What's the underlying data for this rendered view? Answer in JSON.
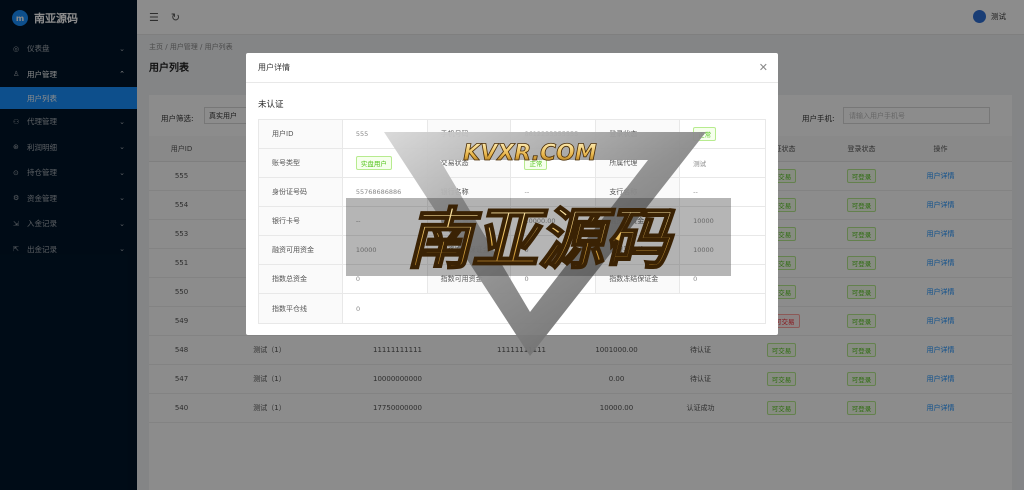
{
  "sidebar": {
    "logo": "南亚源码",
    "items": [
      {
        "label": "仪表盘",
        "icon": "dashboard-icon"
      },
      {
        "label": "用户管理",
        "icon": "user-icon"
      },
      {
        "label": "代理管理",
        "icon": "agent-icon"
      },
      {
        "label": "利润明细",
        "icon": "profit-icon"
      },
      {
        "label": "持仓管理",
        "icon": "position-icon"
      },
      {
        "label": "资金管理",
        "icon": "fund-icon"
      },
      {
        "label": "入金记录",
        "icon": "deposit-icon"
      },
      {
        "label": "出金记录",
        "icon": "withdraw-icon"
      }
    ],
    "sub_item": "用户列表"
  },
  "header": {
    "user_name": "测试"
  },
  "breadcrumb": [
    "主页",
    "用户管理",
    "用户列表"
  ],
  "page_title": "用户列表",
  "filters": {
    "user_filter_label": "用户筛选:",
    "user_filter_value": "真实用户",
    "phone_label": "用户手机:",
    "phone_placeholder": "请输入用户手机号",
    "reset": "重置",
    "search": "查询"
  },
  "table": {
    "headers": [
      "用户ID",
      "",
      "",
      "",
      "",
      "",
      "认证状态",
      "登录状态",
      "操作"
    ],
    "rows": [
      {
        "id": "555",
        "name": "",
        "phone": "",
        "bank": "",
        "amount": "",
        "auth": "",
        "trade": "可交易",
        "login": "可登录",
        "op": "用户详情"
      },
      {
        "id": "554",
        "name": "",
        "phone": "",
        "bank": "",
        "amount": "",
        "auth": "",
        "trade": "可交易",
        "login": "可登录",
        "op": "用户详情"
      },
      {
        "id": "553",
        "name": "",
        "phone": "",
        "bank": "",
        "amount": "",
        "auth": "",
        "trade": "可交易",
        "login": "可登录",
        "op": "用户详情"
      },
      {
        "id": "551",
        "name": "",
        "phone": "",
        "bank": "",
        "amount": "",
        "auth": "",
        "trade": "可交易",
        "login": "可登录",
        "op": "用户详情"
      },
      {
        "id": "550",
        "name": "测试（1）",
        "phone": "447355118737",
        "bank": "郭奔阳",
        "amount": "0.00",
        "auth": "认证成功",
        "trade": "可交易",
        "login": "可登录",
        "op": "用户详情"
      },
      {
        "id": "549",
        "name": "测试（1）",
        "phone": "447355118729",
        "bank": "",
        "amount": "0.00",
        "auth": "待认证",
        "trade": "不可交易",
        "login": "可登录",
        "op": "用户详情"
      },
      {
        "id": "548",
        "name": "测试（1）",
        "phone": "11111111111",
        "bank": "11111111111",
        "amount": "1001000.00",
        "auth": "待认证",
        "trade": "可交易",
        "login": "可登录",
        "op": "用户详情"
      },
      {
        "id": "547",
        "name": "测试（1）",
        "phone": "10000000000",
        "bank": "",
        "amount": "0.00",
        "auth": "待认证",
        "trade": "可交易",
        "login": "可登录",
        "op": "用户详情"
      },
      {
        "id": "540",
        "name": "测试（1）",
        "phone": "17750000000",
        "bank": "",
        "amount": "10000.00",
        "auth": "认证成功",
        "trade": "可交易",
        "login": "可登录",
        "op": "用户详情"
      }
    ]
  },
  "modal": {
    "title": "用户详情",
    "status": "未认证",
    "rows": [
      [
        {
          "l": "用户ID",
          "v": "555"
        },
        {
          "l": "手机号码",
          "v": "8612233355555"
        },
        {
          "l": "登录状态",
          "v": "正常",
          "tag": true
        }
      ],
      [
        {
          "l": "账号类型",
          "v": "实盘用户",
          "tag": true
        },
        {
          "l": "交易状态",
          "v": "正常",
          "tag": true
        },
        {
          "l": "所属代理",
          "v": "测试"
        }
      ],
      [
        {
          "l": "身份证号码",
          "v": "55768686886"
        },
        {
          "l": "银行名称",
          "v": "--"
        },
        {
          "l": "支行名称",
          "v": "--"
        }
      ],
      [
        {
          "l": "银行卡号",
          "v": "--"
        },
        {
          "l": "账户总资金",
          "v": "10000.00"
        },
        {
          "l": "融资总资金",
          "v": "10000"
        }
      ],
      [
        {
          "l": "融资可用资金",
          "v": "10000"
        },
        {
          "l": "融资冻结保证金",
          "v": "0"
        },
        {
          "l": "融资平仓线",
          "v": "10000"
        }
      ],
      [
        {
          "l": "指数总资金",
          "v": "0"
        },
        {
          "l": "指数可用资金",
          "v": "0"
        },
        {
          "l": "指数冻结保证金",
          "v": "0"
        }
      ],
      [
        {
          "l": "指数平仓线",
          "v": "0"
        }
      ]
    ]
  },
  "watermark": {
    "top_text": "KVXR.COM",
    "main_text": "南亚源码"
  }
}
